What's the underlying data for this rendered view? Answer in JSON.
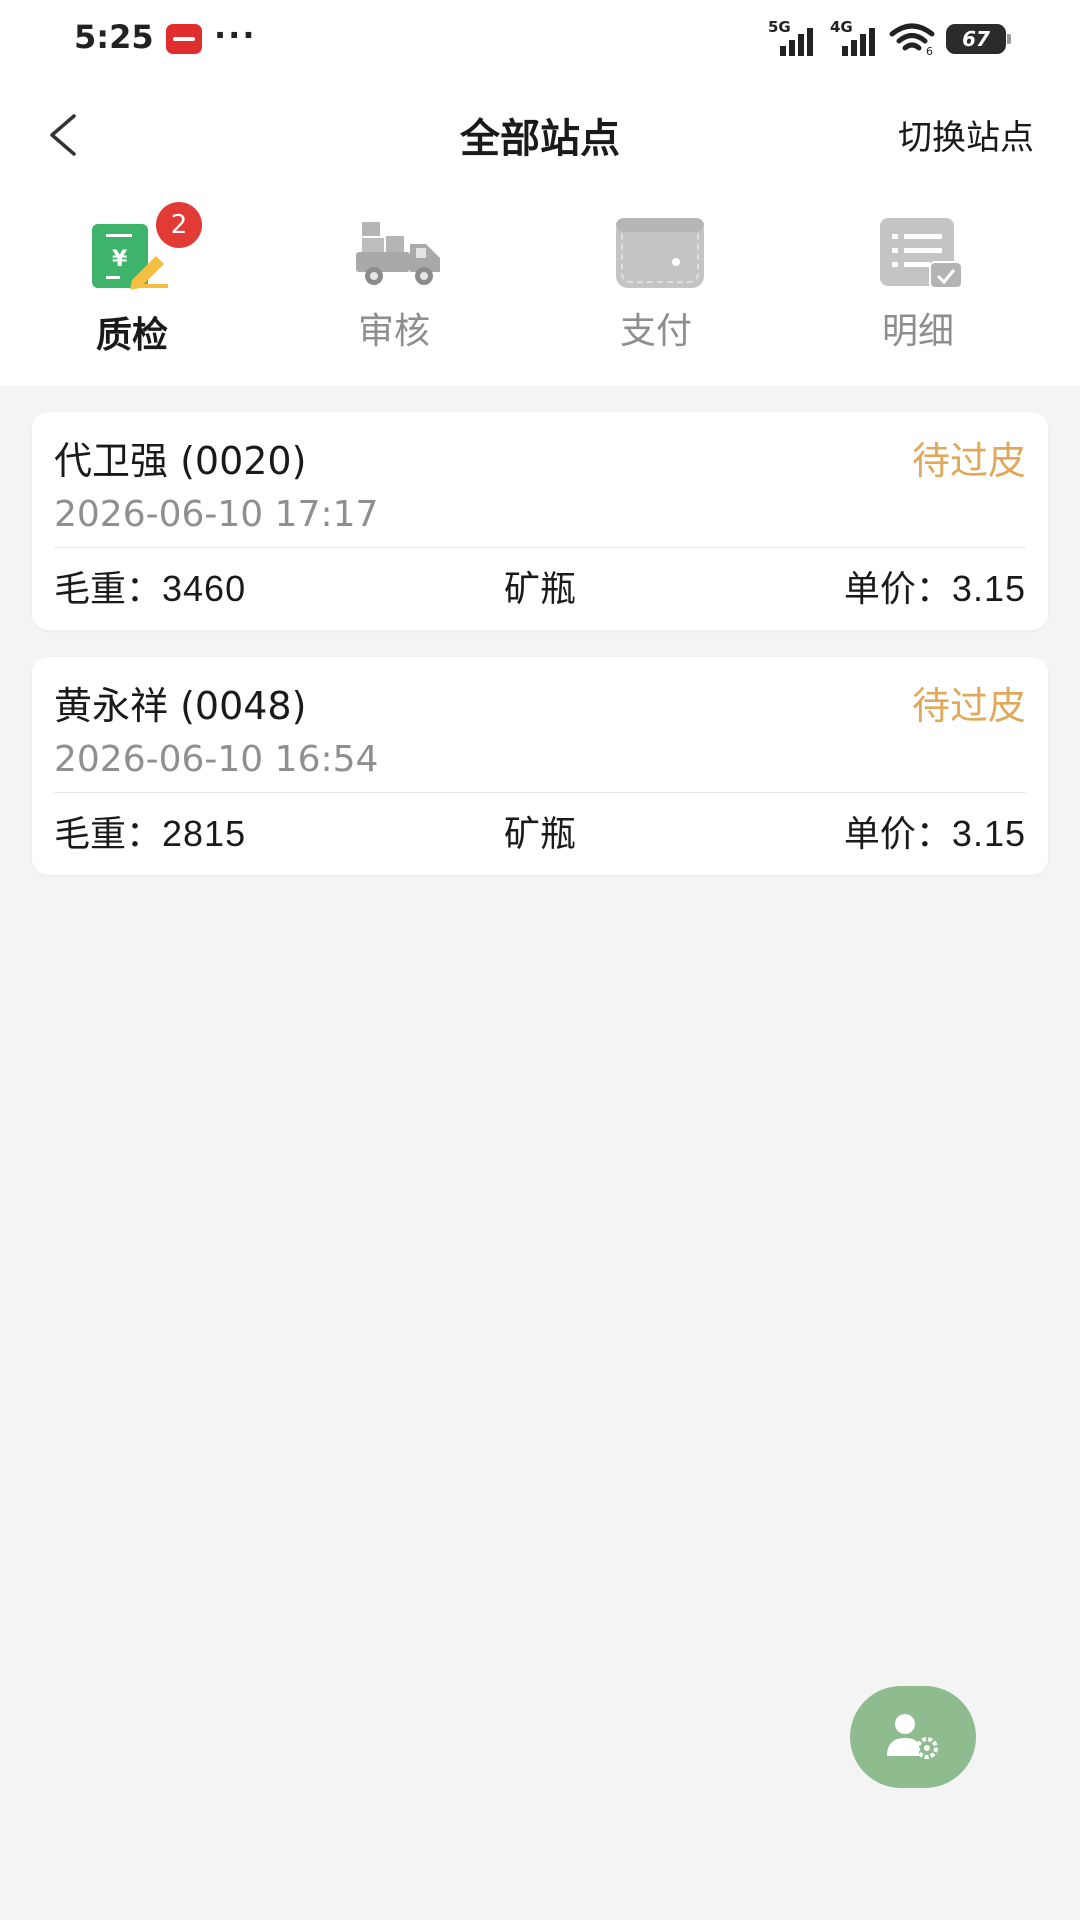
{
  "status_bar": {
    "time": "5:25",
    "network1": "5G",
    "network2": "4G",
    "battery": "67"
  },
  "header": {
    "title": "全部站点",
    "switch_label": "切换站点"
  },
  "tabs": [
    {
      "label": "质检",
      "icon": "quality-check-icon",
      "badge": "2",
      "active": true
    },
    {
      "label": "审核",
      "icon": "truck-icon",
      "active": false
    },
    {
      "label": "支付",
      "icon": "wallet-icon",
      "active": false
    },
    {
      "label": "明细",
      "icon": "detail-list-icon",
      "active": false
    }
  ],
  "records": [
    {
      "name": "代卫强 (0020)",
      "status": "待过皮",
      "time": "2026-06-10 17:17",
      "gross_label": "毛重：",
      "gross": "3460",
      "category": "矿瓶",
      "price_label": "单价：",
      "price": "3.15"
    },
    {
      "name": "黄永祥 (0048)",
      "status": "待过皮",
      "time": "2026-06-10 16:54",
      "gross_label": "毛重：",
      "gross": "2815",
      "category": "矿瓶",
      "price_label": "单价：",
      "price": "3.15"
    }
  ],
  "colors": {
    "status_pending": "#e0a85a",
    "badge": "#e23b36",
    "fab": "#8fbc8f"
  },
  "fab": {
    "icon": "user-settings-icon"
  }
}
